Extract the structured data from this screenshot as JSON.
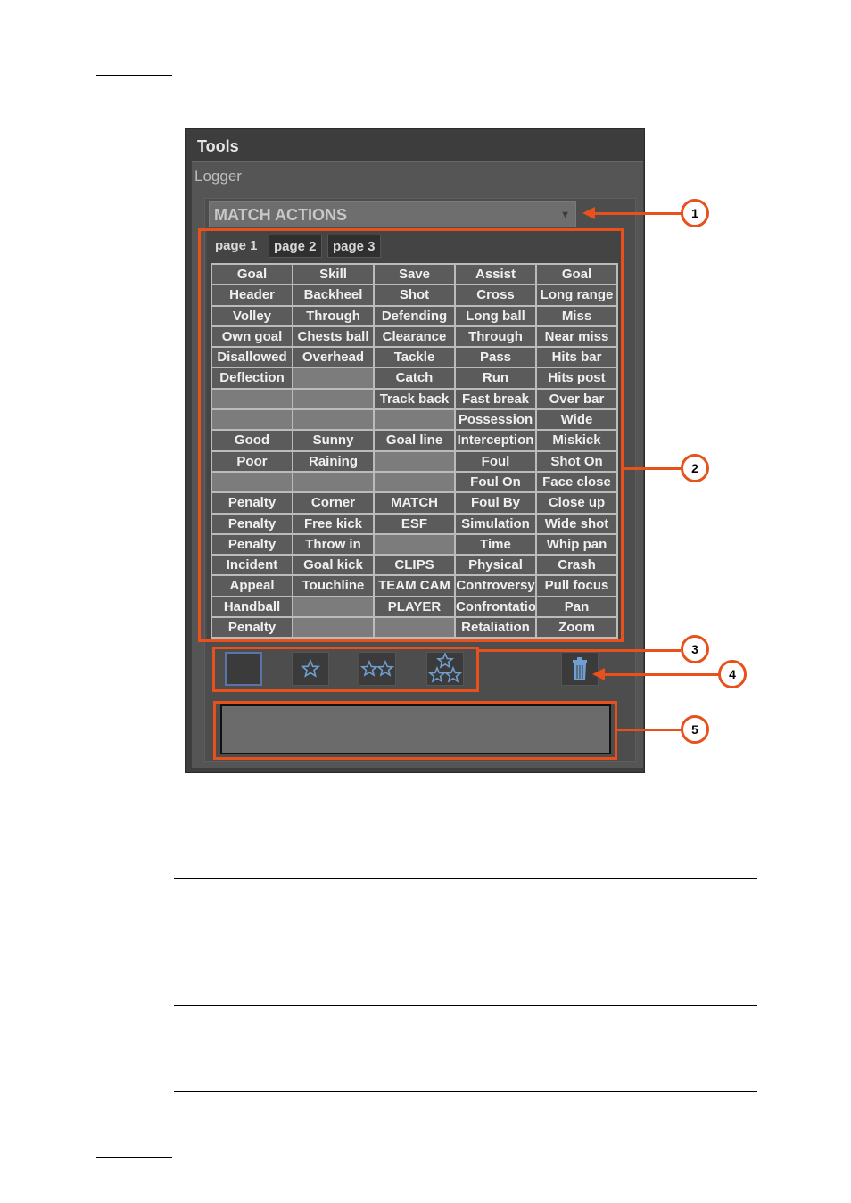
{
  "panel": {
    "title": "Tools",
    "section": "Logger",
    "dropdown": {
      "selected": "MATCH ACTIONS",
      "icon": "chevron-down-icon"
    },
    "tabs": [
      {
        "label": "page 1",
        "active": true
      },
      {
        "label": "page 2",
        "active": false
      },
      {
        "label": "page 3",
        "active": false
      }
    ],
    "grid": [
      [
        "Goal",
        "Skill",
        "Save",
        "Assist",
        "Goal"
      ],
      [
        "Header",
        "Backheel",
        "Shot",
        "Cross",
        "Long range"
      ],
      [
        "Volley",
        "Through",
        "Defending",
        "Long ball",
        "Miss"
      ],
      [
        "Own goal",
        "Chests ball",
        "Clearance",
        "Through",
        "Near miss"
      ],
      [
        "Disallowed",
        "Overhead",
        "Tackle",
        "Pass",
        "Hits bar"
      ],
      [
        "Deflection",
        "",
        "Catch",
        "Run",
        "Hits post"
      ],
      [
        "",
        "",
        "Track back",
        "Fast break",
        "Over bar"
      ],
      [
        "",
        "",
        "",
        "Possession",
        "Wide"
      ],
      [
        "Good",
        "Sunny",
        "Goal line",
        "Interception",
        "Miskick"
      ],
      [
        "Poor",
        "Raining",
        "",
        "Foul",
        "Shot On"
      ],
      [
        "",
        "",
        "",
        "Foul On",
        "Face close"
      ],
      [
        "Penalty",
        "Corner",
        "MATCH",
        "Foul By",
        "Close up"
      ],
      [
        "Penalty",
        "Free kick",
        "ESF",
        "Simulation",
        "Wide shot"
      ],
      [
        "Penalty",
        "Throw in",
        "",
        "Time",
        "Whip pan"
      ],
      [
        "Incident",
        "Goal kick",
        "CLIPS",
        "Physical",
        "Crash"
      ],
      [
        "Appeal",
        "Touchline",
        "TEAM CAM",
        "Controversy",
        "Pull focus"
      ],
      [
        "Handball",
        "",
        "PLAYER",
        "Confrontation",
        "Pan"
      ],
      [
        "Penalty",
        "",
        "",
        "Retaliation",
        "Zoom"
      ]
    ],
    "ratings": [
      {
        "name": "no-rating",
        "stars": 0,
        "selected": true
      },
      {
        "name": "one-star",
        "stars": 1,
        "selected": false
      },
      {
        "name": "two-stars",
        "stars": 2,
        "selected": false
      },
      {
        "name": "three-stars",
        "stars": 3,
        "selected": false
      }
    ],
    "delete_icon": "trash-icon",
    "comment_value": ""
  },
  "callouts": [
    "1",
    "2",
    "3",
    "4",
    "5"
  ],
  "colors": {
    "accent": "#e8501c",
    "star": "#6f9fd0"
  }
}
